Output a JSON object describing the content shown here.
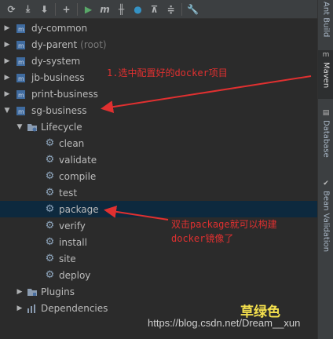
{
  "toolbar": {
    "buttons": [
      "refresh-icon",
      "reimport-icon",
      "download-icon",
      "add-icon",
      "run-icon",
      "execute-goal-icon",
      "toggle-offline-icon",
      "skip-tests-icon",
      "show-dependencies-icon",
      "collapse-all-icon",
      "settings-icon"
    ]
  },
  "sidebar": {
    "tabs": [
      {
        "label": "Ant Build"
      },
      {
        "label": "Maven"
      },
      {
        "label": "Database"
      },
      {
        "label": "Bean Validation"
      }
    ]
  },
  "tree": {
    "modules": [
      {
        "label": "dy-common"
      },
      {
        "label": "dy-parent",
        "suffix": "(root)"
      },
      {
        "label": "dy-system"
      },
      {
        "label": "jb-business"
      },
      {
        "label": "print-business"
      },
      {
        "label": "sg-business"
      }
    ],
    "lifecycle": {
      "label": "Lifecycle"
    },
    "phases": [
      "clean",
      "validate",
      "compile",
      "test",
      "package",
      "verify",
      "install",
      "site",
      "deploy"
    ],
    "plugins": {
      "label": "Plugins"
    },
    "dependencies": {
      "label": "Dependencies"
    }
  },
  "annotations": {
    "step1": "1.选中配置好的docker项目",
    "step2_line1": "双击package就可以构建",
    "step2_line2": "docker镜像了",
    "green_text": "草绿色",
    "watermark": "https://blog.csdn.net/Dream__xun"
  },
  "colors": {
    "background": "#2b2b2b",
    "toolbar": "#3c3f41",
    "selected_row": "#0d293e",
    "annotation_red": "#e03030",
    "run_green": "#59a869",
    "text": "#bbbbbb"
  }
}
